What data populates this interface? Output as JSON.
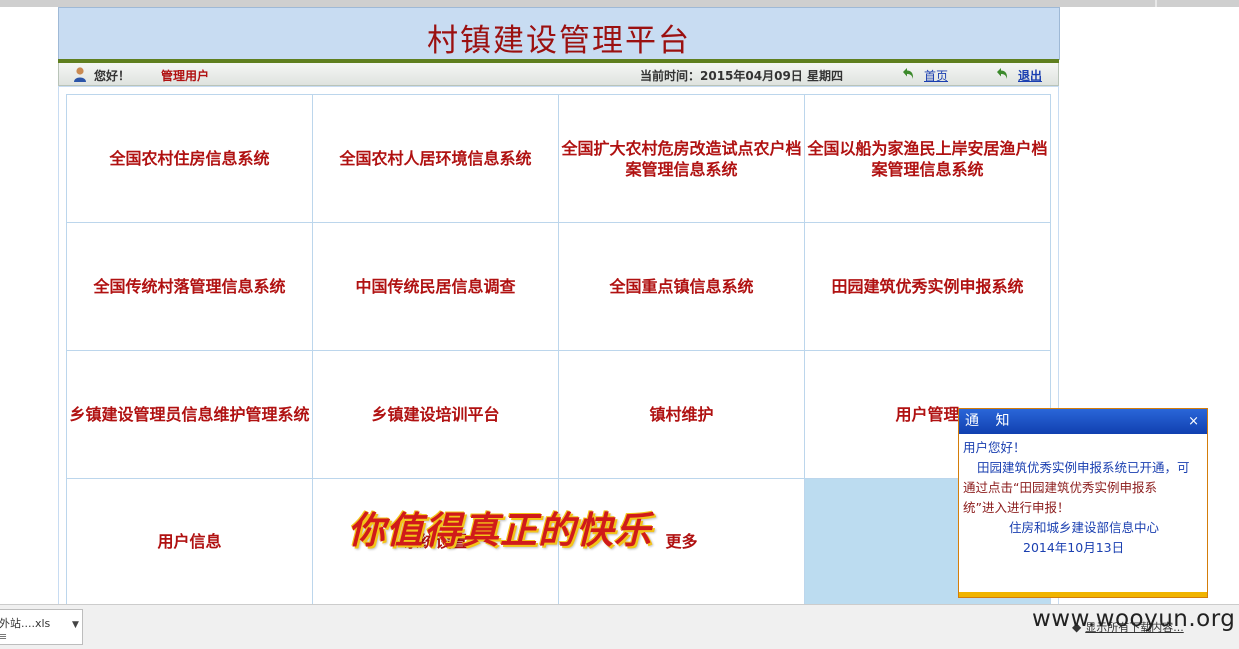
{
  "header": {
    "title": "村镇建设管理平台",
    "greeting": "您好！",
    "username": "管理用户",
    "current_time": "当前时间：2015年04月09日 星期四",
    "home_label": "首页",
    "logout_label": "退出"
  },
  "grid": {
    "cells": [
      {
        "label": "全国农村住房信息系统"
      },
      {
        "label": "全国农村人居环境信息系统"
      },
      {
        "label": "全国扩大农村危房改造试点农户档案管理信息系统"
      },
      {
        "label": "全国以船为家渔民上岸安居渔户档案管理信息系统"
      },
      {
        "label": "全国传统村落管理信息系统"
      },
      {
        "label": "中国传统民居信息调查"
      },
      {
        "label": "全国重点镇信息系统"
      },
      {
        "label": "田园建筑优秀实例申报系统"
      },
      {
        "label": "乡镇建设管理员信息维护管理系统"
      },
      {
        "label": "乡镇建设培训平台"
      },
      {
        "label": "镇村维护"
      },
      {
        "label": "用户管理"
      },
      {
        "label": "用户信息"
      },
      {
        "label": "系统设置"
      },
      {
        "label": "更多"
      },
      {
        "label": ""
      }
    ]
  },
  "overlay": {
    "text": "你值得真正的快乐"
  },
  "notice": {
    "title": "通  知",
    "close": "×",
    "greeting": "用户您好！",
    "line1": "田园建筑优秀实例申报系统已开通，可",
    "line2": "通过点击“田园建筑优秀实例申报系",
    "line3": "统”进入进行申报！",
    "org": "住房和城乡建设部信息中心",
    "date": "2014年10月13日"
  },
  "download_bar": {
    "file_name": "外站....xls",
    "file_sub": "≡",
    "show_all": "显示所有下载内容..."
  },
  "watermark": "www.wooyun.org",
  "colors": {
    "title_red": "#9b1010",
    "link_red": "#b01111",
    "banner_blue": "#c8dcf2",
    "notice_header": "#1140b0"
  }
}
